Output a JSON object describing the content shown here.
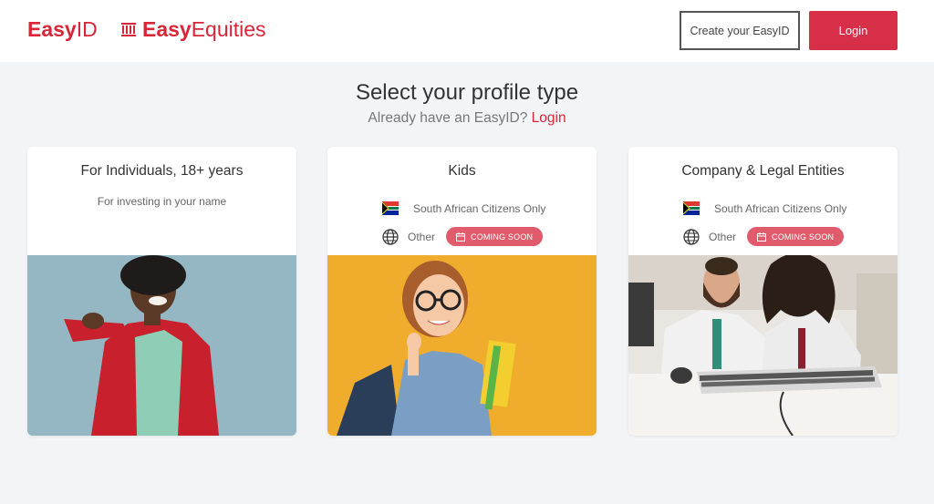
{
  "header": {
    "logo_easyid": {
      "bold": "Easy",
      "light": "ID"
    },
    "logo_easyequities": {
      "bold": "Easy",
      "light": "Equities"
    },
    "create_button": "Create your EasyID",
    "login_button": "Login"
  },
  "main": {
    "title": "Select your profile type",
    "subtitle_prefix": "Already have an EasyID? ",
    "subtitle_link": "Login"
  },
  "cards": [
    {
      "title": "For Individuals, 18+ years",
      "description": "For investing in your name",
      "image": "person-pointing-photo"
    },
    {
      "title": "Kids",
      "sa_label": "South African Citizens Only",
      "other_label": "Other",
      "badge": "COMING SOON",
      "image": "girl-thumbs-up-photo"
    },
    {
      "title": "Company & Legal Entities",
      "sa_label": "South African Citizens Only",
      "other_label": "Other",
      "badge": "COMING SOON",
      "image": "men-at-keyboard-photo"
    }
  ],
  "colors": {
    "accent": "#d72638",
    "button": "#d72f47",
    "badge": "#e05b6c",
    "background": "#f3f4f6"
  },
  "icons": [
    "south-africa-flag-icon",
    "globe-icon",
    "calendar-icon",
    "building-icon"
  ]
}
